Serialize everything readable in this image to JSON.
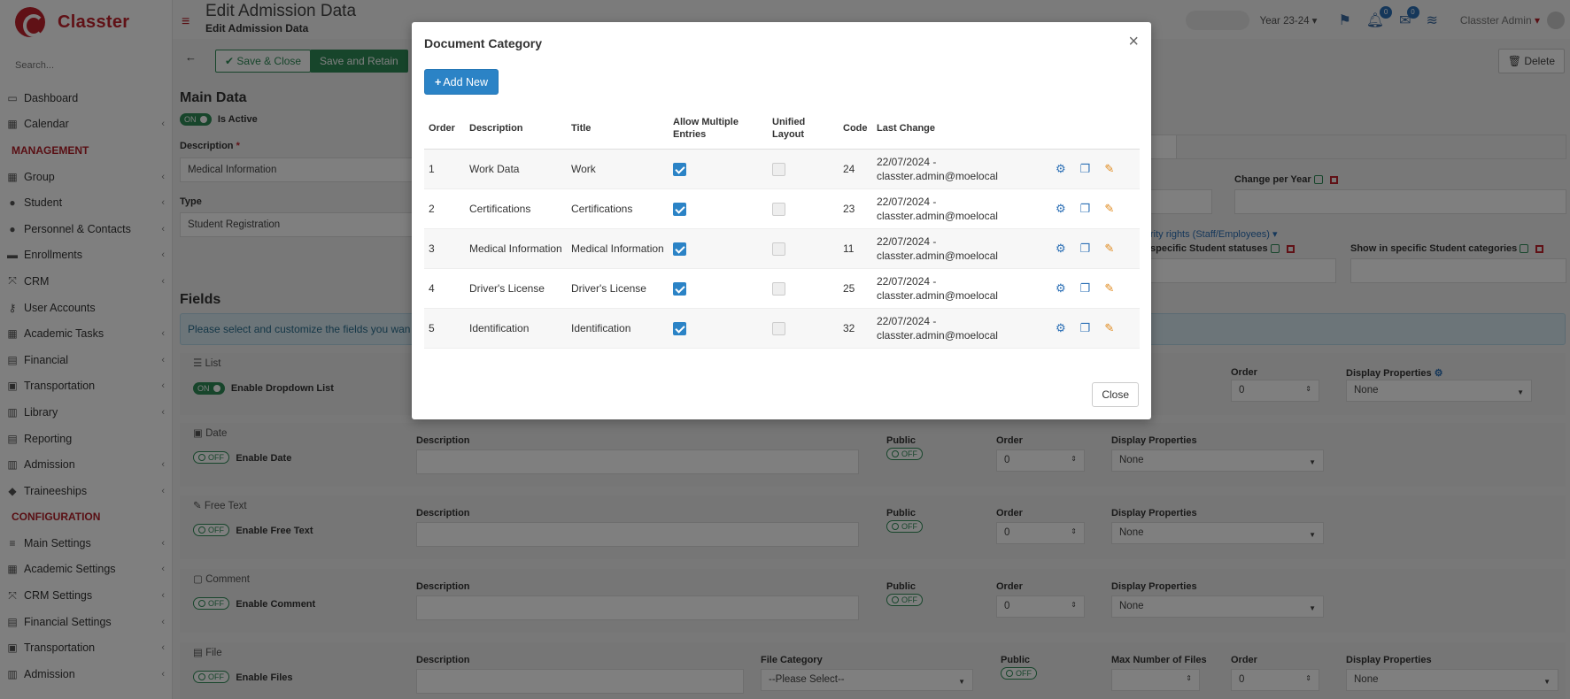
{
  "sidebar": {
    "logo_text": "Classter",
    "search_placeholder": "Search...",
    "items": [
      {
        "label": "Dashboard",
        "icon": "laptop-icon",
        "glyph": "▭",
        "chevron": false
      },
      {
        "label": "Calendar",
        "icon": "calendar-icon",
        "glyph": "▦",
        "chevron": true
      },
      {
        "header": "MANAGEMENT"
      },
      {
        "label": "Group",
        "icon": "group-icon",
        "glyph": "▦",
        "chevron": true
      },
      {
        "label": "Student",
        "icon": "student-icon",
        "glyph": "●",
        "chevron": true
      },
      {
        "label": "Personnel & Contacts",
        "icon": "personnel-icon",
        "glyph": "●",
        "chevron": true
      },
      {
        "label": "Enrollments",
        "icon": "enrollments-icon",
        "glyph": "▬",
        "chevron": true
      },
      {
        "label": "CRM",
        "icon": "crm-icon",
        "glyph": "⤧",
        "chevron": true
      },
      {
        "label": "User Accounts",
        "icon": "key-icon",
        "glyph": "⚷",
        "chevron": false
      },
      {
        "label": "Academic Tasks",
        "icon": "tasks-icon",
        "glyph": "▦",
        "chevron": true
      },
      {
        "label": "Financial",
        "icon": "financial-icon",
        "glyph": "▤",
        "chevron": true
      },
      {
        "label": "Transportation",
        "icon": "bus-icon",
        "glyph": "▣",
        "chevron": true
      },
      {
        "label": "Library",
        "icon": "library-icon",
        "glyph": "▥",
        "chevron": true
      },
      {
        "label": "Reporting",
        "icon": "print-icon",
        "glyph": "▤",
        "chevron": false
      },
      {
        "label": "Admission",
        "icon": "admission-icon",
        "glyph": "▥",
        "chevron": true
      },
      {
        "label": "Traineeships",
        "icon": "traineeships-icon",
        "glyph": "◆",
        "chevron": true
      },
      {
        "header": "CONFIGURATION"
      },
      {
        "label": "Main Settings",
        "icon": "settings-icon",
        "glyph": "≡",
        "chevron": true
      },
      {
        "label": "Academic Settings",
        "icon": "academic-settings-icon",
        "glyph": "▦",
        "chevron": true
      },
      {
        "label": "CRM Settings",
        "icon": "crm-settings-icon",
        "glyph": "⤧",
        "chevron": true
      },
      {
        "label": "Financial Settings",
        "icon": "financial-settings-icon",
        "glyph": "▤",
        "chevron": true
      },
      {
        "label": "Transportation",
        "icon": "bus-icon",
        "glyph": "▣",
        "chevron": true
      },
      {
        "label": "Admission",
        "icon": "admission-icon",
        "glyph": "▥",
        "chevron": true
      }
    ]
  },
  "topbar": {
    "title": "Edit Admission Data",
    "subtitle": "Edit Admission Data",
    "year": "Year 23-24",
    "notifications_count": "0",
    "messages_count": "0",
    "user": "Classter Admin"
  },
  "toolbar": {
    "save_close": "Save & Close",
    "save_retain": "Save and Retain",
    "delete": "Delete"
  },
  "main_data": {
    "title": "Main Data",
    "active_toggle": "ON",
    "active_label": "Is Active",
    "description_label": "Description",
    "description_value": "Medical Information",
    "type_label": "Type",
    "type_value": "Student Registration",
    "change_per_year": "Change per Year",
    "security_link": "rity rights (Staff/Employees)",
    "specific_statuses": "specific Student statuses",
    "specific_categories": "Show in specific Student categories"
  },
  "fields": {
    "title": "Fields",
    "info": "Please select and customize the fields you wan",
    "rows": [
      {
        "group": "List",
        "toggle": "ON",
        "enable": "Enable Dropdown List",
        "order_label": "Order",
        "order_value": "0",
        "display_label": "Display Properties",
        "display_value": "None"
      },
      {
        "group": "Date",
        "toggle": "OFF",
        "enable": "Enable Date",
        "desc_label": "Description",
        "public_label": "Public",
        "public_toggle": "OFF",
        "order_label": "Order",
        "order_value": "0",
        "display_label": "Display Properties",
        "display_value": "None"
      },
      {
        "group": "Free Text",
        "toggle": "OFF",
        "enable": "Enable Free Text",
        "desc_label": "Description",
        "public_label": "Public",
        "public_toggle": "OFF",
        "order_label": "Order",
        "order_value": "0",
        "display_label": "Display Properties",
        "display_value": "None"
      },
      {
        "group": "Comment",
        "toggle": "OFF",
        "enable": "Enable Comment",
        "desc_label": "Description",
        "public_label": "Public",
        "public_toggle": "OFF",
        "order_label": "Order",
        "order_value": "0",
        "display_label": "Display Properties",
        "display_value": "None"
      },
      {
        "group": "File",
        "toggle": "OFF",
        "enable": "Enable Files",
        "desc_label": "Description",
        "file_cat_label": "File Category",
        "file_cat_value": "--Please Select--",
        "public_label": "Public",
        "public_toggle": "OFF",
        "max_label": "Max Number of Files",
        "order_label": "Order",
        "order_value": "0",
        "display_label": "Display Properties",
        "display_value": "None"
      }
    ]
  },
  "modal": {
    "title": "Document Category",
    "close_x": "×",
    "add_new": "Add New",
    "close_button": "Close",
    "columns": [
      "Order",
      "Description",
      "Title",
      "Allow Multiple Entries",
      "Unified Layout",
      "Code",
      "Last Change"
    ],
    "rows": [
      {
        "order": "1",
        "description": "Work Data",
        "title": "Work",
        "allow_multiple": true,
        "unified": false,
        "code": "24",
        "last_change": "22/07/2024 - classter.admin@moelocal"
      },
      {
        "order": "2",
        "description": "Certifications",
        "title": "Certifications",
        "allow_multiple": true,
        "unified": false,
        "code": "23",
        "last_change": "22/07/2024 - classter.admin@moelocal"
      },
      {
        "order": "3",
        "description": "Medical Information",
        "title": "Medical Information",
        "allow_multiple": true,
        "unified": false,
        "code": "11",
        "last_change": "22/07/2024 - classter.admin@moelocal"
      },
      {
        "order": "4",
        "description": "Driver's License",
        "title": "Driver's License",
        "allow_multiple": true,
        "unified": false,
        "code": "25",
        "last_change": "22/07/2024 - classter.admin@moelocal"
      },
      {
        "order": "5",
        "description": "Identification",
        "title": "Identification",
        "allow_multiple": true,
        "unified": false,
        "code": "32",
        "last_change": "22/07/2024 - classter.admin@moelocal"
      }
    ]
  }
}
